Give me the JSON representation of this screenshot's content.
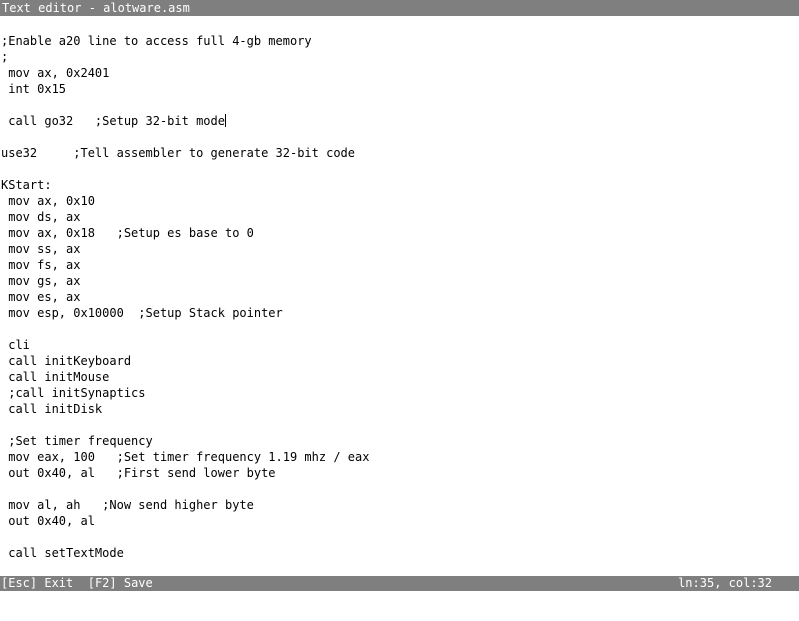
{
  "window": {
    "title": "Text editor - alotware.asm"
  },
  "editor": {
    "lines": [
      ";Enable a20 line to access full 4-gb memory",
      ";",
      " mov ax, 0x2401",
      " int 0x15",
      "",
      " call go32   ;Setup 32-bit mode",
      "",
      "use32     ;Tell assembler to generate 32-bit code",
      "",
      "KStart:",
      " mov ax, 0x10",
      " mov ds, ax",
      " mov ax, 0x18   ;Setup es base to 0",
      " mov ss, ax",
      " mov fs, ax",
      " mov gs, ax",
      " mov es, ax",
      " mov esp, 0x10000  ;Setup Stack pointer",
      "",
      " cli",
      " call initKeyboard",
      " call initMouse",
      " ;call initSynaptics",
      " call initDisk",
      "",
      " ;Set timer frequency",
      " mov eax, 100   ;Set timer frequency 1.19 mhz / eax",
      " out 0x40, al   ;First send lower byte",
      "",
      " mov al, ah   ;Now send higher byte",
      " out 0x40, al",
      "",
      " call setTextMode"
    ]
  },
  "statusbar": {
    "esc_key": "[Esc]",
    "esc_label": "Exit",
    "f2_key": "[F2]",
    "f2_label": "Save",
    "position": "ln:35, col:32"
  },
  "colors": {
    "bar_background": "#7f7f7f",
    "bar_text": "#ffffff",
    "editor_background": "#ffffff",
    "editor_text": "#000000"
  }
}
